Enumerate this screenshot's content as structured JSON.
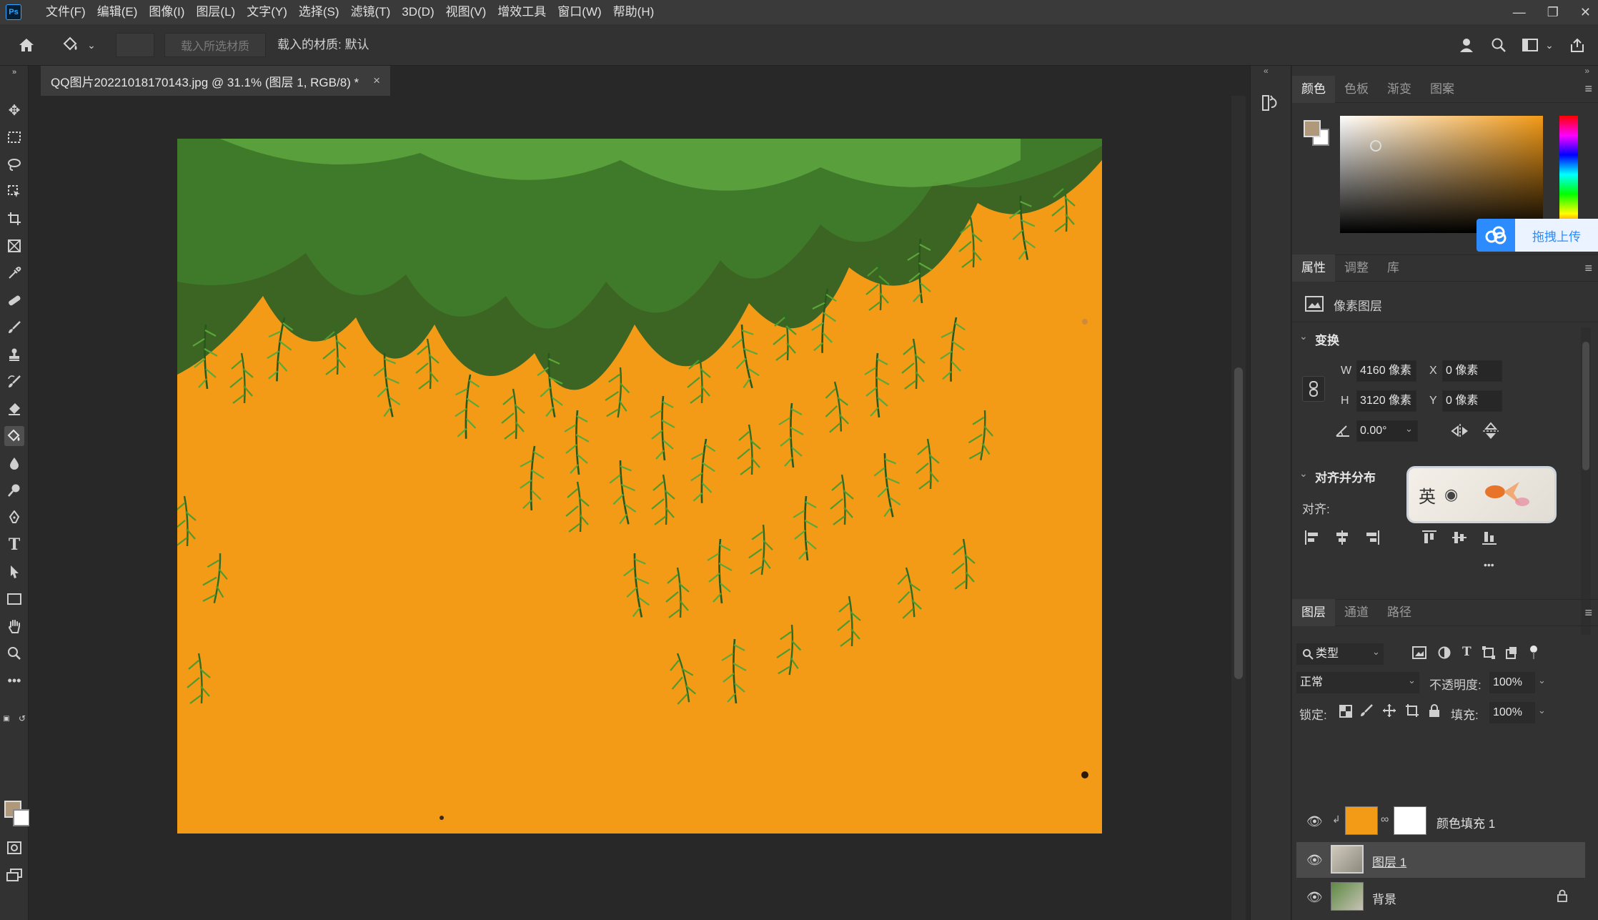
{
  "app": {
    "logo": "Ps"
  },
  "menu": [
    "文件(F)",
    "编辑(E)",
    "图像(I)",
    "图层(L)",
    "文字(Y)",
    "选择(S)",
    "滤镜(T)",
    "3D(D)",
    "视图(V)",
    "增效工具",
    "窗口(W)",
    "帮助(H)"
  ],
  "options_bar": {
    "load_selected_placeholder": "载入所选材质",
    "loaded_material": "载入的材质: 默认"
  },
  "document": {
    "tab_title": "QQ图片20221018170143.jpg @ 31.1% (图层 1, RGB/8) *",
    "close": "×",
    "canvas_color": "#f39a16"
  },
  "color_panel": {
    "tabs": [
      "颜色",
      "色板",
      "渐变",
      "图案"
    ],
    "foreground": "#b0987a",
    "background": "#ffffff",
    "upload_label": "拖拽上传"
  },
  "properties_panel": {
    "tabs": [
      "属性",
      "调整",
      "库"
    ],
    "layer_type": "像素图层",
    "transform_title": "变换",
    "w_label": "W",
    "w_value": "4160 像素",
    "h_label": "H",
    "h_value": "3120 像素",
    "x_label": "X",
    "x_value": "0 像素",
    "y_label": "Y",
    "y_value": "0 像素",
    "angle": "0.00°",
    "align_title": "对齐并分布",
    "align_label": "对齐:",
    "ime_text": "英",
    "more": "•••"
  },
  "layers_panel": {
    "tabs": [
      "图层",
      "通道",
      "路径"
    ],
    "filter_type": "类型",
    "blend_mode": "正常",
    "opacity_label": "不透明度:",
    "opacity": "100%",
    "lock_label": "锁定:",
    "fill_label": "填充:",
    "fill": "100%",
    "layers": [
      {
        "name": "颜色填充 1",
        "thumb_color": "#f39a16"
      },
      {
        "name": "图层 1",
        "selected": true
      },
      {
        "name": "背景",
        "locked": true
      }
    ]
  }
}
